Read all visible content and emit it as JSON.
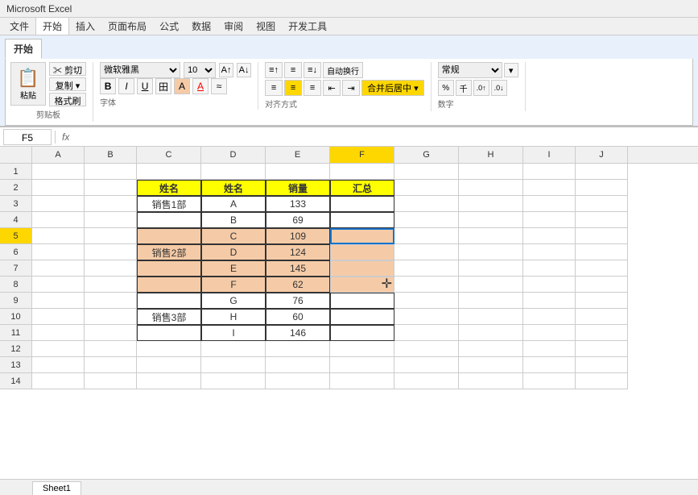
{
  "titlebar": {
    "text": "Microsoft Excel"
  },
  "menubar": {
    "items": [
      "文件",
      "开始",
      "插入",
      "页面布局",
      "公式",
      "数据",
      "审阅",
      "视图",
      "开发工具"
    ]
  },
  "ribbon": {
    "tabs": [
      "开始"
    ],
    "clipboard": {
      "paste": "粘贴",
      "cut": "✂ 剪切",
      "copy": "复制 ▾",
      "format_painter": "格式刷",
      "label": "剪贴板"
    },
    "font": {
      "name": "微软雅黑",
      "size": "10",
      "bold": "B",
      "italic": "I",
      "underline": "U",
      "border": "田",
      "fill": "A",
      "color": "A",
      "label": "字体"
    },
    "alignment": {
      "top": "⊤",
      "middle": "≡",
      "bottom": "⊥",
      "left": "≡",
      "center": "≡",
      "right": "≡",
      "wrap": "自动换行",
      "merge": "合并后居中 ▾",
      "label": "对齐方式"
    },
    "number": {
      "format": "常规",
      "label": "数字"
    }
  },
  "formulabar": {
    "cell": "F5",
    "fx": "fx"
  },
  "columns": [
    "A",
    "B",
    "C",
    "D",
    "E",
    "F",
    "G",
    "H",
    "I",
    "J"
  ],
  "rows": [
    {
      "num": 1,
      "cells": [
        "",
        "",
        "",
        "",
        "",
        "",
        "",
        "",
        "",
        ""
      ]
    },
    {
      "num": 2,
      "cells": [
        "",
        "",
        "姓名",
        "姓名",
        "销量",
        "汇总",
        "",
        "",
        "",
        ""
      ]
    },
    {
      "num": 3,
      "cells": [
        "",
        "",
        "销售1部",
        "A",
        "133",
        "",
        "",
        "",
        "",
        ""
      ]
    },
    {
      "num": 4,
      "cells": [
        "",
        "",
        "",
        "B",
        "69",
        "",
        "",
        "",
        "",
        ""
      ]
    },
    {
      "num": 5,
      "cells": [
        "",
        "",
        "",
        "C",
        "109",
        "",
        "",
        "",
        "",
        ""
      ]
    },
    {
      "num": 6,
      "cells": [
        "",
        "",
        "销售2部",
        "D",
        "124",
        "",
        "",
        "",
        "",
        ""
      ]
    },
    {
      "num": 7,
      "cells": [
        "",
        "",
        "",
        "E",
        "145",
        "",
        "",
        "",
        "",
        ""
      ]
    },
    {
      "num": 8,
      "cells": [
        "",
        "",
        "",
        "F",
        "62",
        "",
        "",
        "",
        "",
        ""
      ]
    },
    {
      "num": 9,
      "cells": [
        "",
        "",
        "",
        "G",
        "76",
        "",
        "",
        "",
        "",
        ""
      ]
    },
    {
      "num": 10,
      "cells": [
        "",
        "",
        "销售3部",
        "H",
        "60",
        "",
        "",
        "",
        "",
        ""
      ]
    },
    {
      "num": 11,
      "cells": [
        "",
        "",
        "",
        "I",
        "146",
        "",
        "",
        "",
        "",
        ""
      ]
    },
    {
      "num": 12,
      "cells": [
        "",
        "",
        "",
        "",
        "",
        "",
        "",
        "",
        "",
        ""
      ]
    },
    {
      "num": 13,
      "cells": [
        "",
        "",
        "",
        "",
        "",
        "",
        "",
        "",
        "",
        ""
      ]
    },
    {
      "num": 14,
      "cells": [
        "",
        "",
        "",
        "",
        "",
        "",
        "",
        "",
        "",
        ""
      ]
    }
  ],
  "sheet_tabs": [
    "Sheet1"
  ]
}
